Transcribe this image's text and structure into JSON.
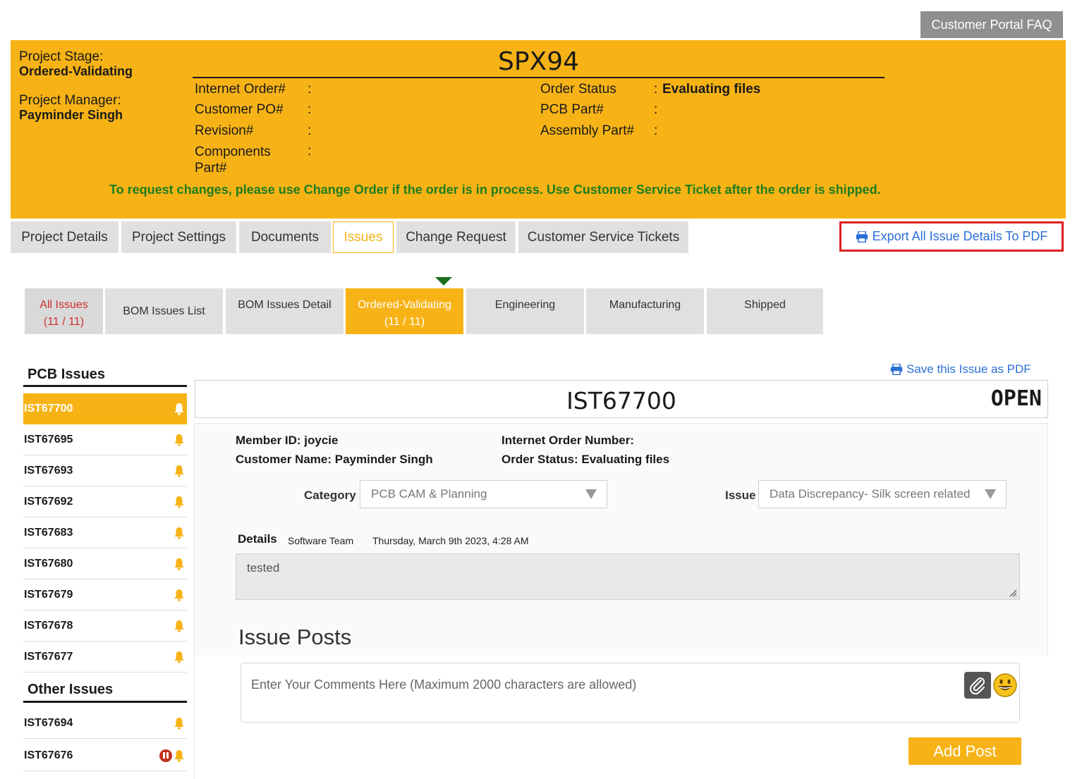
{
  "header": {
    "faq_button": "Customer Portal FAQ"
  },
  "banner": {
    "stage_label": "Project Stage:",
    "stage_value": "Ordered-Validating",
    "pm_label": "Project Manager:",
    "pm_value": "Payminder Singh",
    "project_code": "SPX94",
    "fields_left": [
      {
        "label": "Internet Order#",
        "colon": ":",
        "value": ""
      },
      {
        "label": "Customer PO#",
        "colon": ":",
        "value": ""
      },
      {
        "label": "Revision#",
        "colon": ":",
        "value": ""
      },
      {
        "label": "Components Part#",
        "colon": ":",
        "value": ""
      }
    ],
    "fields_right": [
      {
        "label": "Order Status",
        "colon": ":",
        "value": "Evaluating files"
      },
      {
        "label": "PCB Part#",
        "colon": ":",
        "value": ""
      },
      {
        "label": "Assembly Part#",
        "colon": ":",
        "value": ""
      }
    ],
    "notice": "To request changes, please use Change Order if the order is in process. Use Customer Service Ticket after the order is shipped."
  },
  "tabs": [
    "Project Details",
    "Project Settings",
    "Documents",
    "Issues",
    "Change Request",
    "Customer Service Tickets"
  ],
  "active_tab": "Issues",
  "export_button": "Export All Issue Details To PDF",
  "subtabs": [
    {
      "label": "All Issues",
      "count": "(11 / 11)"
    },
    {
      "label": "BOM Issues List",
      "count": ""
    },
    {
      "label": "BOM Issues Detail",
      "count": ""
    },
    {
      "label": "Ordered-Validating",
      "count": "(11 / 11)"
    },
    {
      "label": "Engineering",
      "count": ""
    },
    {
      "label": "Manufacturing",
      "count": ""
    },
    {
      "label": "Shipped",
      "count": ""
    }
  ],
  "pcb_issues": {
    "title": "PCB Issues",
    "items": [
      "IST67700",
      "IST67695",
      "IST67693",
      "IST67692",
      "IST67683",
      "IST67680",
      "IST67679",
      "IST67678",
      "IST67677"
    ]
  },
  "other_issues": {
    "title": "Other Issues",
    "items": [
      "IST67694",
      "IST67676"
    ]
  },
  "issue": {
    "save_pdf": "Save this Issue as PDF",
    "id": "IST67700",
    "status": "OPEN",
    "member_id": "Member ID: joycie",
    "customer_name": "Customer Name: Payminder Singh",
    "internet_order": "Internet Order Number:",
    "order_status": "Order Status: Evaluating files",
    "category_label": "Category",
    "category_value": "PCB CAM & Planning",
    "issue_label": "Issue",
    "issue_value": "Data Discrepancy- Silk screen related",
    "details_label": "Details",
    "details_team": "Software Team",
    "details_date": "Thursday, March 9th 2023, 4:28 AM",
    "details_text": "tested"
  },
  "posts": {
    "title": "Issue Posts",
    "placeholder": "Enter Your Comments Here (Maximum 2000 characters are allowed)",
    "add_button": "Add Post"
  },
  "colors": {
    "accent": "#f7b316",
    "link": "#2a6fd6",
    "notice": "#1e7d1e",
    "alert": "#c0301f"
  }
}
